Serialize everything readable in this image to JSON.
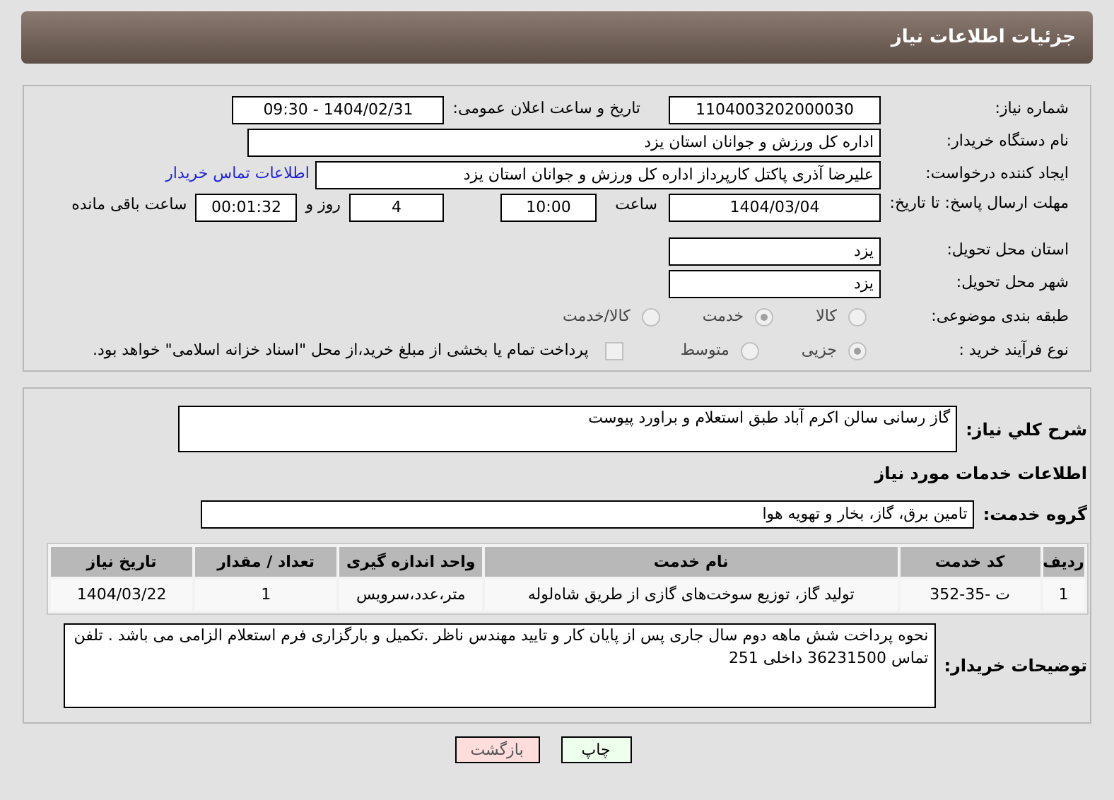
{
  "header": {
    "title": "جزئیات اطلاعات نیاز"
  },
  "need_number": {
    "label": "شماره نیاز:",
    "value": "1104003202000030"
  },
  "announce": {
    "label": "تاریخ و ساعت اعلان عمومی:",
    "value": "1404/02/31 - 09:30"
  },
  "buyer_org": {
    "label": "نام دستگاه خریدار:",
    "value": "اداره کل ورزش و جوانان استان یزد"
  },
  "requester": {
    "label": "ایجاد کننده درخواست:",
    "value": "علیرضا آذری پاکتل کارپرداز اداره کل ورزش و جوانان استان یزد",
    "link": "اطلاعات تماس خریدار"
  },
  "deadline": {
    "label": "مهلت ارسال پاسخ: تا تاریخ:",
    "date": "1404/03/04",
    "time_label": "ساعت",
    "time": "10:00",
    "days": "4",
    "days_label": "روز و",
    "remaining": "00:01:32",
    "remaining_label": "ساعت باقی مانده"
  },
  "province": {
    "label": "استان محل تحویل:",
    "value": "یزد"
  },
  "city": {
    "label": "شهر محل تحویل:",
    "value": "یزد"
  },
  "category": {
    "label": "طبقه بندی موضوعی:",
    "options": [
      {
        "label": "کالا",
        "selected": false
      },
      {
        "label": "خدمت",
        "selected": true
      },
      {
        "label": "کالا/خدمت",
        "selected": false
      }
    ]
  },
  "purchase_type": {
    "label": "نوع فرآیند خرید :",
    "options": [
      {
        "label": "جزیی",
        "selected": true
      },
      {
        "label": "متوسط",
        "selected": false
      }
    ],
    "payment_note": {
      "label": "پرداخت تمام یا بخشی از مبلغ خرید،از محل \"اسناد خزانه اسلامی\" خواهد بود.",
      "checked": false
    }
  },
  "description": {
    "label": "شرح کلي نياز:",
    "value": "گاز رسانی سالن اکرم آباد طبق استعلام و براورد پیوست"
  },
  "services_title": "اطلاعات خدمات مورد نیاز",
  "service_group": {
    "label": "گروه خدمت:",
    "value": "تامین برق، گاز، بخار و تهویه هوا"
  },
  "table": {
    "columns": [
      "ردیف",
      "کد خدمت",
      "نام خدمت",
      "واحد اندازه گیری",
      "تعداد / مقدار",
      "تاریخ نیاز"
    ],
    "rows": [
      [
        "1",
        "ت -35-352",
        "تولید گاز، توزیع سوخت‌های گازی از طریق شاه‌لوله",
        "متر،عدد،سرویس",
        "1",
        "1404/03/22"
      ]
    ]
  },
  "buyer_notes": {
    "label": "توضیحات خریدار:",
    "value": "نحوه پرداخت شش ماهه دوم سال جاری پس از پایان کار و تایید مهندس ناظر .تکمیل و بارگزاری فرم استعلام  الزامی می باشد . تلفن تماس 36231500 داخلی 251"
  },
  "buttons": [
    {
      "label": "چاپ",
      "kind": "print"
    },
    {
      "label": "بازگشت",
      "kind": "back"
    }
  ]
}
